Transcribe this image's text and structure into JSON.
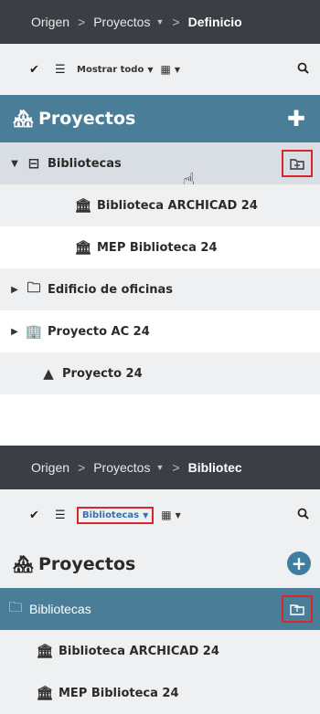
{
  "top": {
    "breadcrumb": [
      {
        "label": "Origen"
      },
      {
        "label": "Proyectos"
      },
      {
        "label": "Definicio"
      }
    ],
    "toolbar": {
      "filter_label": "Mostrar todo"
    },
    "header": {
      "title": "Proyectos"
    },
    "tree": [
      {
        "label": "Bibliotecas"
      },
      {
        "label": "Biblioteca ARCHICAD 24"
      },
      {
        "label": "MEP Biblioteca 24"
      },
      {
        "label": "Edificio de oficinas"
      },
      {
        "label": "Proyecto AC 24"
      },
      {
        "label": "Proyecto 24"
      }
    ]
  },
  "bottom": {
    "breadcrumb": [
      {
        "label": "Origen"
      },
      {
        "label": "Proyectos"
      },
      {
        "label": "Bibliotec"
      }
    ],
    "toolbar": {
      "filter_label": "Bibliotecas"
    },
    "header": {
      "title": "Proyectos"
    },
    "tree": [
      {
        "label": "Bibliotecas"
      },
      {
        "label": "Biblioteca ARCHICAD 24"
      },
      {
        "label": "MEP Biblioteca 24"
      }
    ]
  },
  "icons": {
    "check": "checkmark-icon",
    "list": "list-icon",
    "calendar": "calendar-icon",
    "search": "search-icon",
    "add": "plus-icon",
    "library_folder": "library-folder-icon",
    "library": "library-building-icon",
    "folder": "folder-icon",
    "project": "building-icon",
    "move_up": "move-up-icon"
  },
  "colors": {
    "breadcrumb_bg": "#3b3f45",
    "accent": "#4a7e98",
    "highlight_border": "#d9262c",
    "row_grey": "#eef0f2"
  }
}
